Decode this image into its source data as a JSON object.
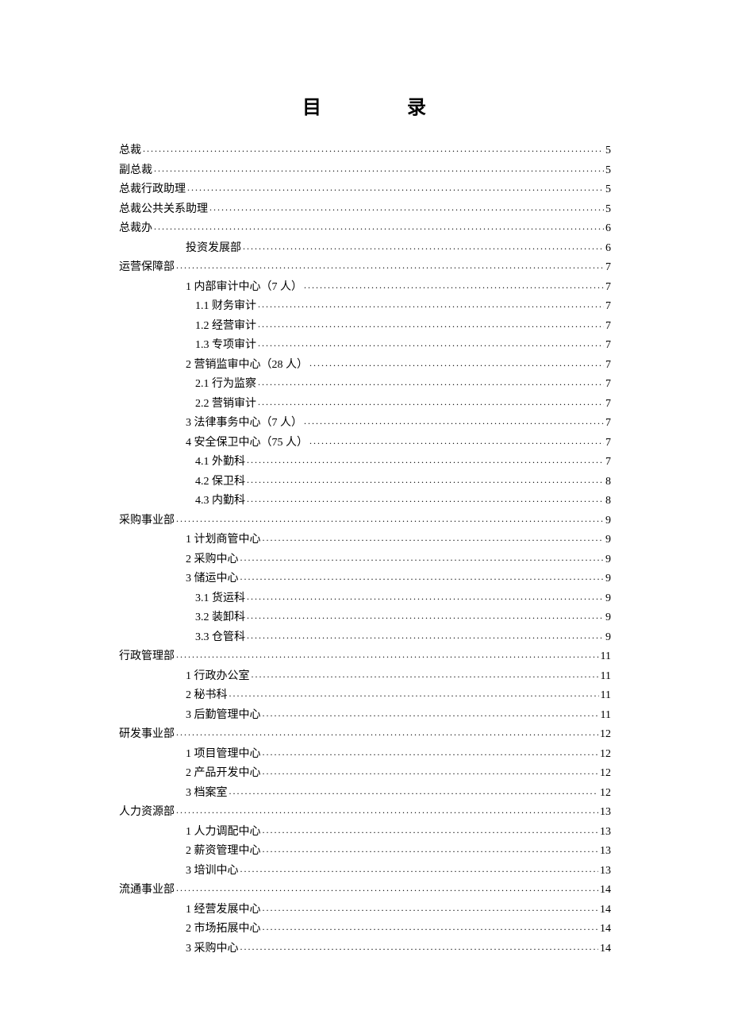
{
  "title": {
    "char1": "目",
    "char2": "录"
  },
  "entries": [
    {
      "label": "总裁",
      "page": "5",
      "level": 0
    },
    {
      "label": "副总裁",
      "page": "5",
      "level": 0
    },
    {
      "label": "总裁行政助理",
      "page": "5",
      "level": 0
    },
    {
      "label": "总裁公共关系助理",
      "page": "5",
      "level": 0
    },
    {
      "label": "总裁办",
      "page": "6",
      "level": 0
    },
    {
      "label": "投资发展部",
      "page": "6",
      "level": 1
    },
    {
      "label": "运营保障部",
      "page": "7",
      "level": 0
    },
    {
      "label": "1 内部审计中心（7 人）",
      "page": "7",
      "level": 1
    },
    {
      "label": "1.1 财务审计",
      "page": "7",
      "level": 2
    },
    {
      "label": "1.2 经营审计",
      "page": "7",
      "level": 2
    },
    {
      "label": "1.3 专项审计",
      "page": "7",
      "level": 2
    },
    {
      "label": "2 营销监审中心（28 人）",
      "page": "7",
      "level": 1
    },
    {
      "label": "2.1 行为监察",
      "page": "7",
      "level": 2
    },
    {
      "label": "2.2 营销审计",
      "page": "7",
      "level": 2
    },
    {
      "label": "3 法律事务中心（7 人）",
      "page": "7",
      "level": 1
    },
    {
      "label": "4 安全保卫中心（75 人）",
      "page": "7",
      "level": 1
    },
    {
      "label": "4.1 外勤科",
      "page": "7",
      "level": 2
    },
    {
      "label": "4.2 保卫科",
      "page": "8",
      "level": 2
    },
    {
      "label": "4.3 内勤科",
      "page": "8",
      "level": 2
    },
    {
      "label": "采购事业部",
      "page": "9",
      "level": 0
    },
    {
      "label": "1 计划商管中心",
      "page": "9",
      "level": 1
    },
    {
      "label": "2 采购中心",
      "page": "9",
      "level": 1
    },
    {
      "label": "3 储运中心",
      "page": "9",
      "level": 1
    },
    {
      "label": "3.1 货运科",
      "page": "9",
      "level": 2
    },
    {
      "label": "3.2 装卸科",
      "page": "9",
      "level": 2
    },
    {
      "label": "3.3 仓管科",
      "page": "9",
      "level": 2
    },
    {
      "label": "行政管理部",
      "page": "11",
      "level": 0
    },
    {
      "label": "1 行政办公室",
      "page": "11",
      "level": 1
    },
    {
      "label": "2 秘书科",
      "page": "11",
      "level": 1
    },
    {
      "label": "3 后勤管理中心",
      "page": "11",
      "level": 1
    },
    {
      "label": "研发事业部",
      "page": "12",
      "level": 0
    },
    {
      "label": "1 项目管理中心",
      "page": "12",
      "level": 1
    },
    {
      "label": "2 产品开发中心",
      "page": "12",
      "level": 1
    },
    {
      "label": "3 档案室",
      "page": "12",
      "level": 1
    },
    {
      "label": "人力资源部",
      "page": "13",
      "level": 0
    },
    {
      "label": "1 人力调配中心",
      "page": "13",
      "level": 1
    },
    {
      "label": "2 薪资管理中心",
      "page": "13",
      "level": 1
    },
    {
      "label": "3 培训中心",
      "page": "13",
      "level": 1
    },
    {
      "label": "流通事业部",
      "page": "14",
      "level": 0
    },
    {
      "label": "1 经营发展中心",
      "page": "14",
      "level": 1
    },
    {
      "label": "2 市场拓展中心",
      "page": "14",
      "level": 1
    },
    {
      "label": "3 采购中心",
      "page": "14",
      "level": 1
    }
  ]
}
